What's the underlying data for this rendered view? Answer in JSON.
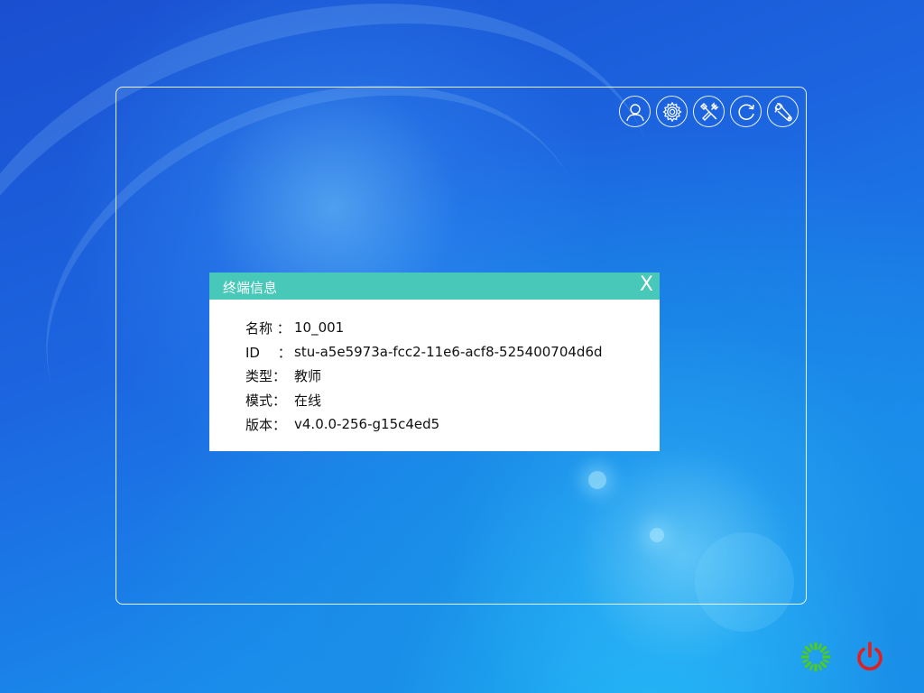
{
  "toolbar": {
    "icons": [
      "user-icon",
      "settings-gear-icon",
      "tools-icon",
      "refresh-icon",
      "wrench-icon"
    ]
  },
  "dialog": {
    "title": "终端信息",
    "close_label": "X",
    "rows": [
      {
        "label": "名称 ：",
        "value": "10_001"
      },
      {
        "label": "ID　 ：",
        "value": "stu-a5e5973a-fcc2-11e6-acf8-525400704d6d"
      },
      {
        "label": "类型：",
        "value": "教师"
      },
      {
        "label": "模式：",
        "value": "在线"
      },
      {
        "label": "版本：",
        "value": "v4.0.0-256-g15c4ed5"
      }
    ]
  },
  "taskbar": {
    "loading_icon": "spinner-icon",
    "power_icon": "power-icon"
  },
  "colors": {
    "dialog_header": "#47c8b8",
    "spinner": "#4ecb1e",
    "power": "#e02020"
  }
}
